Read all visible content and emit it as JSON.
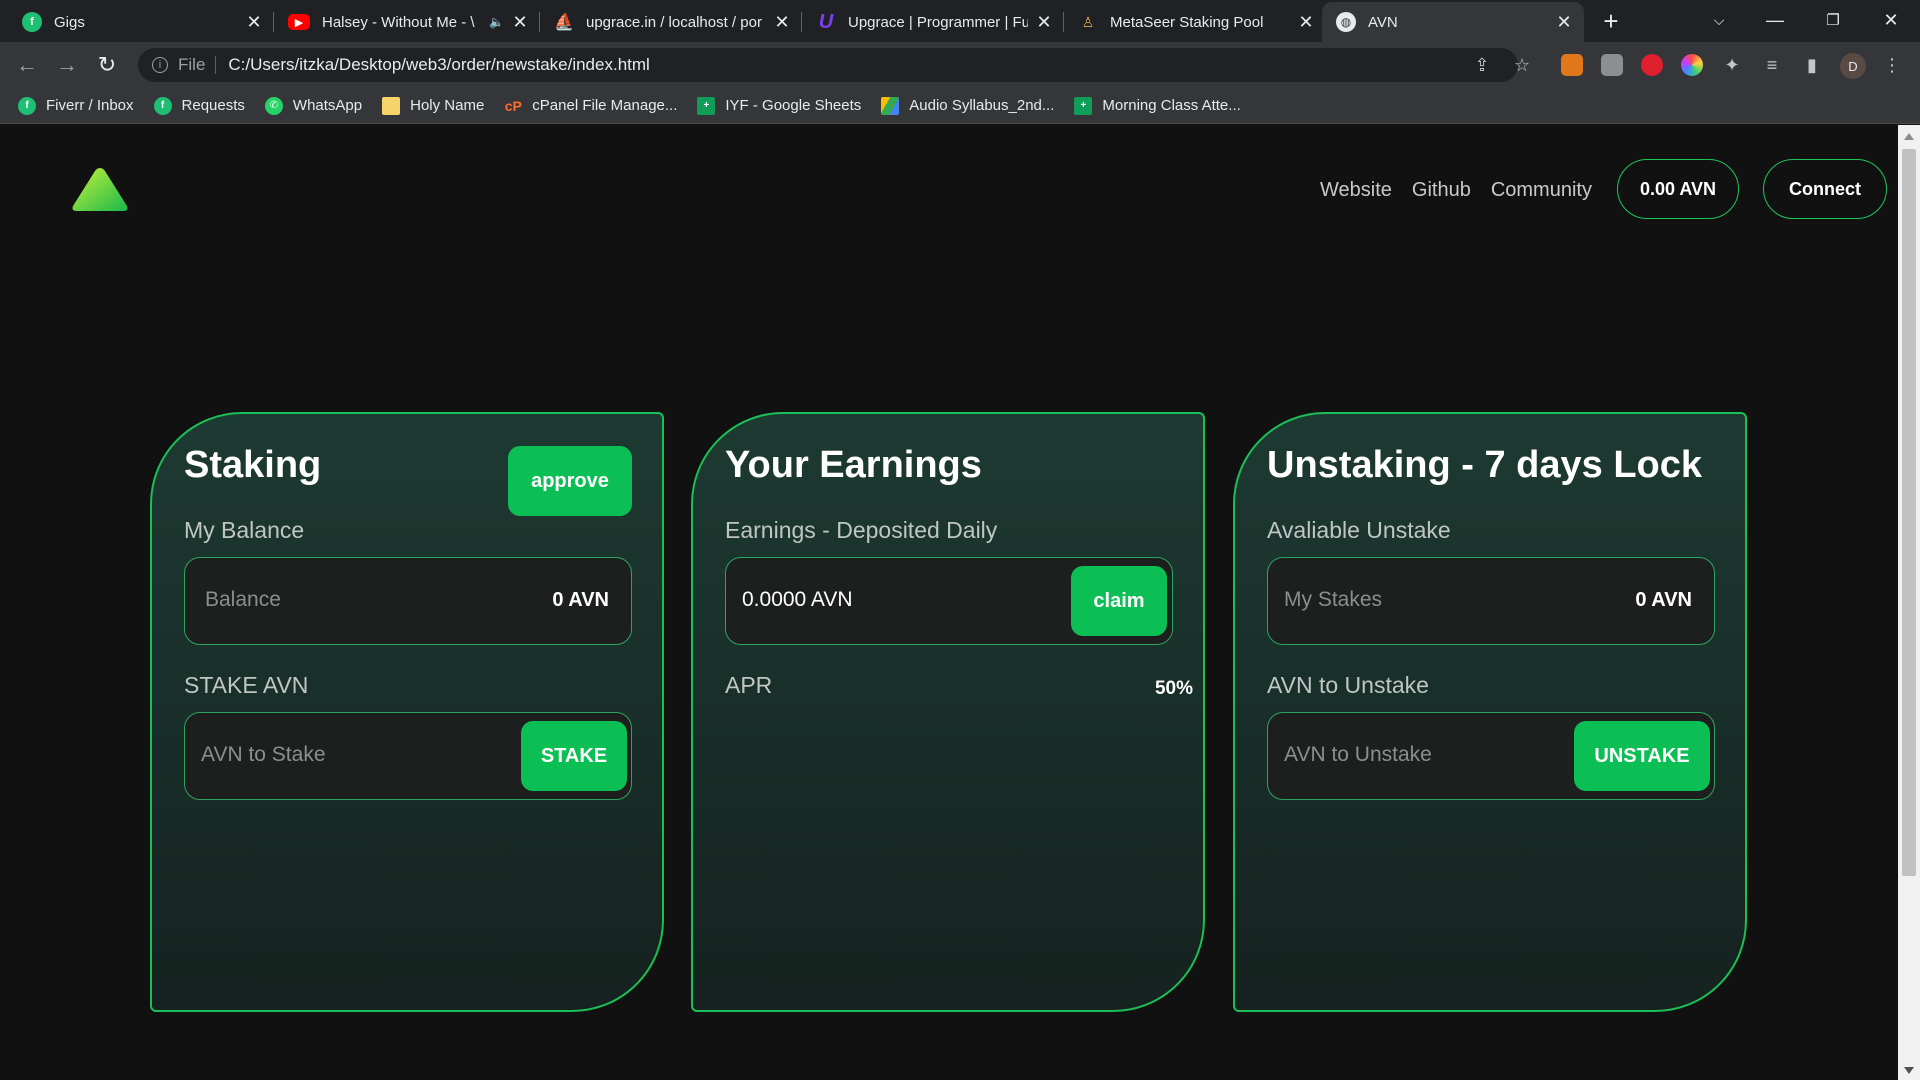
{
  "browser": {
    "tabs": [
      {
        "title": "Gigs",
        "favicon": "fiverr-icon",
        "color": "#1dbf73"
      },
      {
        "title": "Halsey - Without Me - \\",
        "favicon": "youtube-icon",
        "color": "#ff0000"
      },
      {
        "title": "upgrace.in / localhost / por",
        "favicon": "phpmyadmin-icon",
        "color": "#f29111"
      },
      {
        "title": "Upgrace | Programmer | Ful",
        "favicon": "upgrace-icon",
        "color": "#6b2bd9"
      },
      {
        "title": "MetaSeer Staking Pool",
        "favicon": "metaseer-icon",
        "color": "#d6a64a"
      },
      {
        "title": "AVN",
        "favicon": "globe-icon",
        "color": "#9aa0a6"
      }
    ],
    "new_tab": "+",
    "address": {
      "scheme": "File",
      "url": "C:/Users/itzka/Desktop/web3/order/newstake/index.html"
    },
    "bookmarks": [
      {
        "label": "Fiverr / Inbox",
        "icon": "fiverr-icon",
        "color": "#1dbf73"
      },
      {
        "label": "Requests",
        "icon": "fiverr-icon",
        "color": "#1dbf73"
      },
      {
        "label": "WhatsApp",
        "icon": "whatsapp-icon",
        "color": "#25d366"
      },
      {
        "label": "Holy Name",
        "icon": "folder-icon",
        "color": "#f6d36b"
      },
      {
        "label": "cPanel File Manage...",
        "icon": "cpanel-icon",
        "color": "#ff6c2c"
      },
      {
        "label": "IYF - Google Sheets",
        "icon": "sheets-icon",
        "color": "#0f9d58"
      },
      {
        "label": "Audio Syllabus_2nd...",
        "icon": "drive-icon",
        "color": "#4285f4"
      },
      {
        "label": "Morning Class Atte...",
        "icon": "sheets-icon",
        "color": "#0f9d58"
      }
    ],
    "profile_initial": "D"
  },
  "header": {
    "nav": [
      "Website",
      "Github",
      "Community"
    ],
    "balance_pill": "0.00 AVN",
    "connect_label": "Connect"
  },
  "staking": {
    "title": "Staking",
    "approve_label": "approve",
    "balance_heading": "My Balance",
    "balance_placeholder": "Balance",
    "balance_value": "0 AVN",
    "stake_heading": "STAKE AVN",
    "stake_placeholder": "AVN to Stake",
    "stake_label": "STAKE"
  },
  "earnings": {
    "title": "Your Earnings",
    "subtitle": "Earnings - Deposited Daily",
    "amount": "0.0000 AVN",
    "claim_label": "claim",
    "apr_label": "APR",
    "apr_value": "50%"
  },
  "unstaking": {
    "title": "Unstaking - 7 days Lock",
    "available_heading": "Avaliable Unstake",
    "stakes_placeholder": "My Stakes",
    "stakes_value": "0 AVN",
    "unstake_heading": "AVN to Unstake",
    "unstake_placeholder": "AVN to Unstake",
    "unstake_label": "UNSTAKE"
  },
  "colors": {
    "accent": "#0cbf55",
    "card_border": "#1bbf55",
    "page_bg": "#111111"
  }
}
